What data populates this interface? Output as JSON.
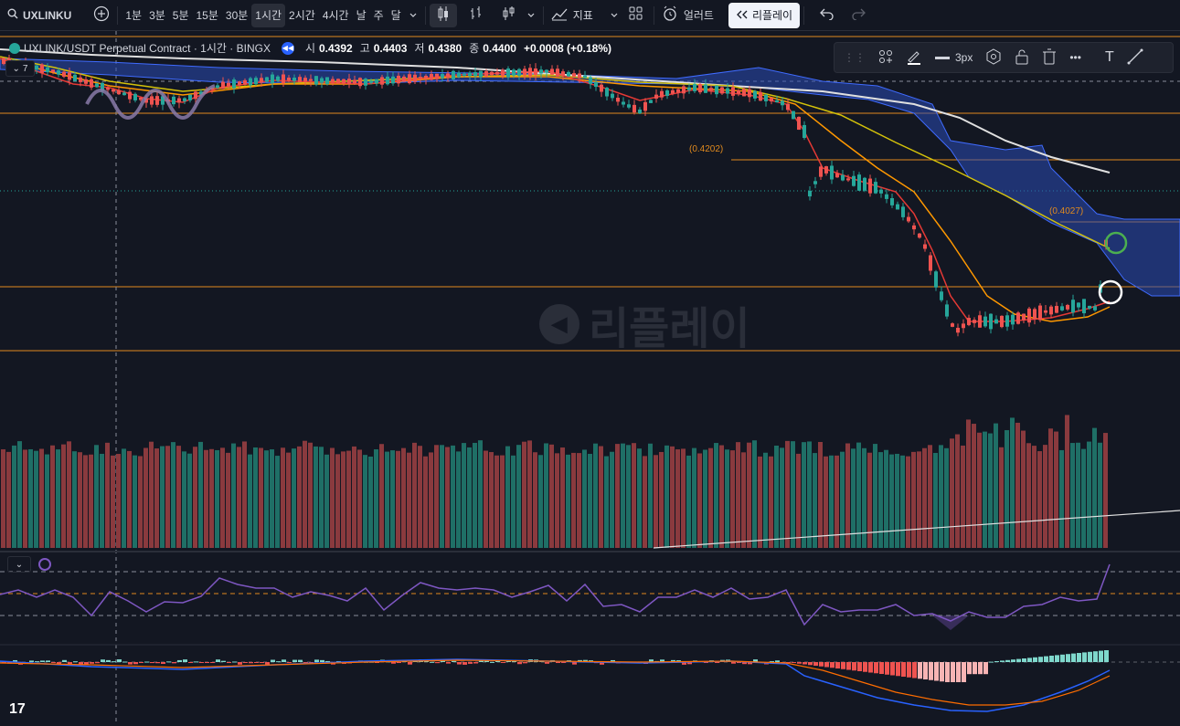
{
  "toolbar": {
    "symbol": "UXLINKU",
    "intervals": [
      "1분",
      "3분",
      "5분",
      "15분",
      "30분",
      "1시간",
      "2시간",
      "4시간",
      "날",
      "주",
      "달"
    ],
    "active_interval": "1시간",
    "indicators_label": "지표",
    "alert_label": "얼러트",
    "replay_label": "리플레이"
  },
  "legend": {
    "title": "UXLINK/USDT Perpetual Contract · 1시간 · BINGX",
    "open_label": "시",
    "open": "0.4392",
    "high_label": "고",
    "high": "0.4403",
    "low_label": "저",
    "low": "0.4380",
    "close_label": "종",
    "close": "0.4400",
    "change": "+0.0008 (+0.18%)",
    "indicator_count": "7"
  },
  "draw_toolbar": {
    "width_label": "3px"
  },
  "annotations": {
    "fib_upper": "(0.4202)",
    "fib_lower": "(0.4027)"
  },
  "watermark": "리플레이",
  "colors": {
    "bull": "#26a69a",
    "bear": "#ef5350",
    "vol_bull": "#1f6f66",
    "vol_bear": "#8a3a3e",
    "ema_fast": "#e53935",
    "ema_mid": "#ff9800",
    "ema_slow": "#d4c20a",
    "ma_long": "#e0e0e0",
    "cloud": "#2a4bb5",
    "fib_line": "#e08a1e",
    "rsi": "#7e57c2",
    "macd": "#2962ff",
    "signal": "#ff6d00"
  }
}
